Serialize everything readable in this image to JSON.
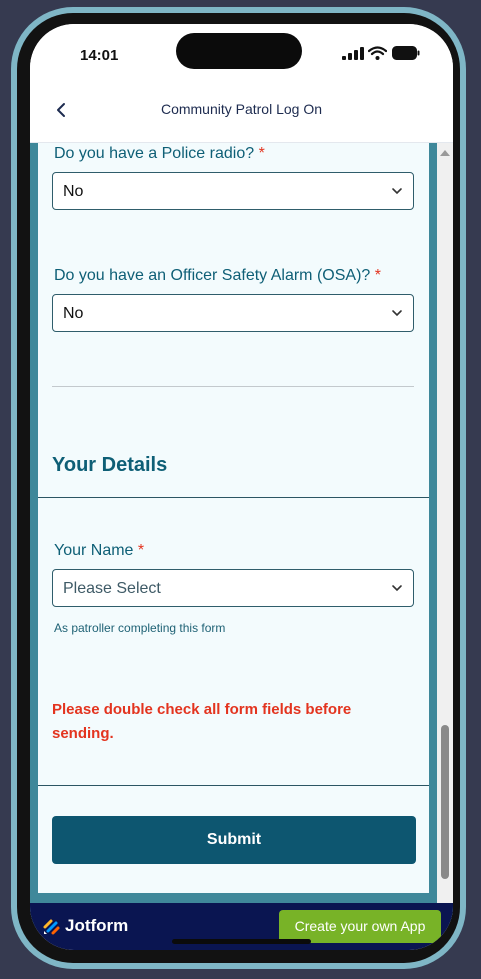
{
  "status": {
    "time": "14:01"
  },
  "nav": {
    "title": "Community Patrol Log On"
  },
  "form": {
    "fields": [
      {
        "label": "Do you have a Police radio?",
        "required_mark": "*",
        "value": "No"
      },
      {
        "label": "Do you have an Officer Safety Alarm (OSA)?",
        "required_mark": "*",
        "value": "No"
      }
    ],
    "section_heading": "Your Details",
    "name_field": {
      "label": "Your Name",
      "required_mark": "*",
      "placeholder": "Please Select",
      "helper": "As patroller completing this form"
    },
    "warning": "Please double check all form fields before sending.",
    "submit_label": "Submit"
  },
  "footer": {
    "brand": "Jotform",
    "cta_label": "Create your own App"
  },
  "colors": {
    "accent": "#0e5f76",
    "error": "#e3341f",
    "button": "#0d5670",
    "footer": "#0a1551",
    "cta": "#78b327"
  },
  "icons": {
    "back": "chevron-left-icon",
    "select": "chevron-down-icon",
    "brand": "jotform-logo-icon"
  }
}
